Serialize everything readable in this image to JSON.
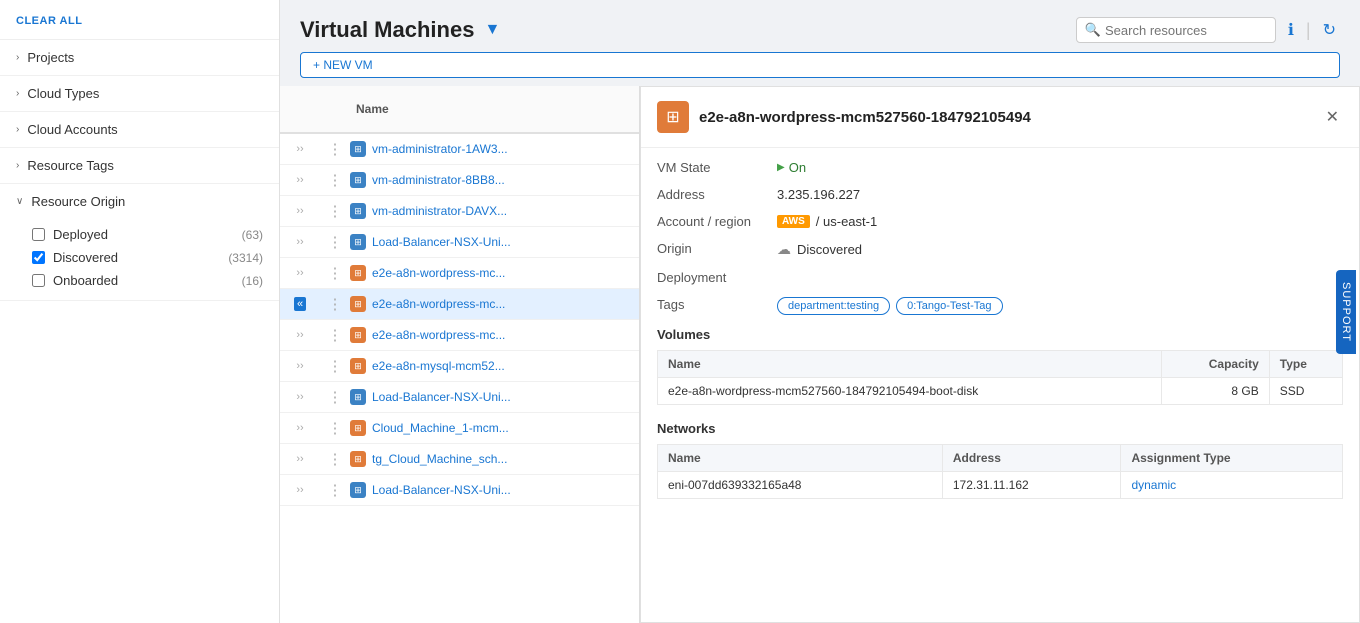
{
  "sidebar": {
    "clear_all": "CLEAR ALL",
    "sections": [
      {
        "id": "projects",
        "label": "Projects",
        "expanded": false
      },
      {
        "id": "cloud_types",
        "label": "Cloud Types",
        "expanded": false
      },
      {
        "id": "cloud_accounts",
        "label": "Cloud Accounts",
        "expanded": false
      },
      {
        "id": "resource_tags",
        "label": "Resource Tags",
        "expanded": false
      },
      {
        "id": "resource_origin",
        "label": "Resource Origin",
        "expanded": true,
        "items": [
          {
            "id": "deployed",
            "label": "Deployed",
            "count": "(63)",
            "checked": false
          },
          {
            "id": "discovered",
            "label": "Discovered",
            "count": "(3314)",
            "checked": true
          },
          {
            "id": "onboarded",
            "label": "Onboarded",
            "count": "(16)",
            "checked": false
          }
        ]
      }
    ]
  },
  "header": {
    "title": "Virtual Machines",
    "new_vm_label": "+ NEW VM",
    "search_placeholder": "Search resources"
  },
  "list": {
    "column_name": "Name",
    "rows": [
      {
        "id": 1,
        "name": "vm-administrator-1AW3...",
        "icon_type": "blue",
        "selected": false
      },
      {
        "id": 2,
        "name": "vm-administrator-8BB8...",
        "icon_type": "blue",
        "selected": false
      },
      {
        "id": 3,
        "name": "vm-administrator-DAVX...",
        "icon_type": "blue",
        "selected": false
      },
      {
        "id": 4,
        "name": "Load-Balancer-NSX-Uni...",
        "icon_type": "blue",
        "selected": false
      },
      {
        "id": 5,
        "name": "e2e-a8n-wordpress-mc...",
        "icon_type": "orange",
        "selected": false
      },
      {
        "id": 6,
        "name": "e2e-a8n-wordpress-mc...",
        "icon_type": "orange",
        "selected": true
      },
      {
        "id": 7,
        "name": "e2e-a8n-wordpress-mc...",
        "icon_type": "orange",
        "selected": false
      },
      {
        "id": 8,
        "name": "e2e-a8n-mysql-mcm52...",
        "icon_type": "orange",
        "selected": false
      },
      {
        "id": 9,
        "name": "Load-Balancer-NSX-Uni...",
        "icon_type": "blue",
        "selected": false
      },
      {
        "id": 10,
        "name": "Cloud_Machine_1-mcm...",
        "icon_type": "orange",
        "selected": false
      },
      {
        "id": 11,
        "name": "tg_Cloud_Machine_sch...",
        "icon_type": "orange",
        "selected": false
      },
      {
        "id": 12,
        "name": "Load-Balancer-NSX-Uni...",
        "icon_type": "blue",
        "selected": false
      }
    ]
  },
  "detail": {
    "title": "e2e-a8n-wordpress-mcm527560-184792105494",
    "vm_state_label": "VM State",
    "vm_state_value": "On",
    "address_label": "Address",
    "address_value": "3.235.196.227",
    "account_region_label": "Account / region",
    "account_value": "AWS / us-east-1",
    "origin_label": "Origin",
    "origin_value": "Discovered",
    "deployment_label": "Deployment",
    "deployment_value": "",
    "tags_label": "Tags",
    "tags": [
      "department:testing",
      "0:Tango-Test-Tag"
    ],
    "volumes_label": "Volumes",
    "volumes_table": {
      "columns": [
        "Name",
        "Capacity",
        "Type"
      ],
      "rows": [
        {
          "name": "e2e-a8n-wordpress-mcm527560-184792105494-boot-disk",
          "capacity": "8 GB",
          "type": "SSD"
        }
      ]
    },
    "networks_label": "Networks",
    "networks_table": {
      "columns": [
        "Name",
        "Address",
        "Assignment Type"
      ],
      "rows": [
        {
          "name": "eni-007dd639332165a48",
          "address": "172.31.11.162",
          "assignment_type": "dynamic"
        }
      ]
    }
  },
  "support_tab": "SUPPORT"
}
